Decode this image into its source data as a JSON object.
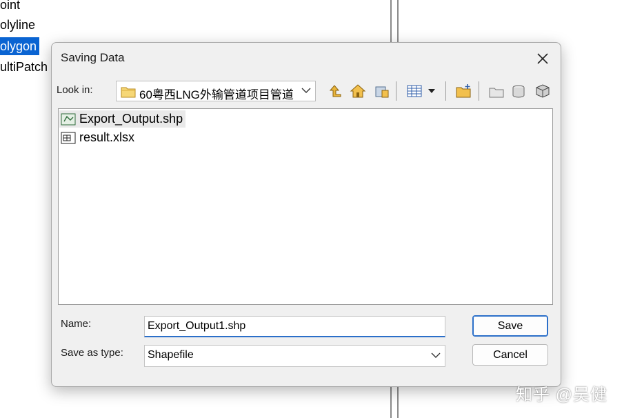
{
  "background": {
    "list_items": [
      "oint",
      "olyline",
      "olygon",
      "ultiPatch"
    ],
    "selected_index": 2
  },
  "dialog": {
    "title": "Saving Data",
    "look_in_label": "Look in:",
    "look_in_value": "60粤西LNG外输管道项目管道",
    "toolbar_icons": [
      "up-one-level-icon",
      "home-icon",
      "connect-folder-icon",
      "view-list-icon",
      "view-dropdown-icon",
      "new-folder-icon",
      "new-file-icon",
      "new-database-icon",
      "connect-database-icon"
    ],
    "files": [
      {
        "name": "Export_Output.shp",
        "icon": "shapefile-icon",
        "selected": true
      },
      {
        "name": "result.xlsx",
        "icon": "table-icon",
        "selected": false
      }
    ],
    "name_label": "Name:",
    "name_value": "Export_Output1.shp",
    "type_label": "Save as type:",
    "type_value": "Shapefile",
    "save_label": "Save",
    "cancel_label": "Cancel"
  },
  "watermark": "知乎 @吴健",
  "colors": {
    "selection_blue": "#0a64d2",
    "focus_blue": "#2b6fc9",
    "dialog_bg": "#f0f0f0"
  }
}
